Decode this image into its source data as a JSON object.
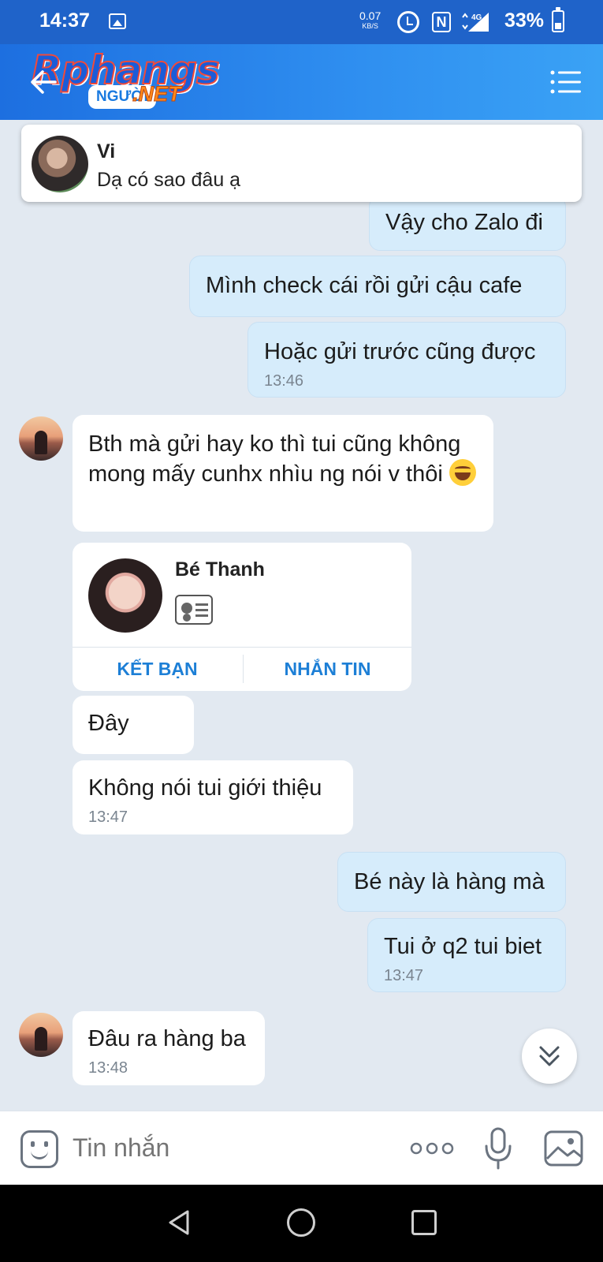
{
  "status_bar": {
    "time": "14:37",
    "net_speed": "0.07",
    "net_speed_unit": "KB/S",
    "nfc": "N",
    "network_type": "4G",
    "battery": "33%"
  },
  "header": {
    "logo_main": "Rphangs",
    "logo_sub": "NGƯỜI",
    "logo_net": ".NET"
  },
  "pinned": {
    "name": "Vi",
    "message": "Dạ có sao đâu ạ"
  },
  "messages": [
    {
      "sender": "me",
      "text": "Vậy cho Zalo đi"
    },
    {
      "sender": "me",
      "text": "Mình check cái rồi gửi cậu cafe"
    },
    {
      "sender": "me",
      "text": "Hoặc gửi trước cũng được",
      "time": "13:46"
    },
    {
      "sender": "other",
      "text": "Bth mà gửi hay ko thì tui cũng không mong mấy cunhx nhìu ng nói v thôi"
    },
    {
      "sender": "other",
      "text": "Đây"
    },
    {
      "sender": "other",
      "text": "Không nói tui giới thiệu",
      "time": "13:47"
    },
    {
      "sender": "me",
      "text": "Bé này là hàng mà"
    },
    {
      "sender": "me",
      "text": "Tui ở q2 tui biet",
      "time": "13:47"
    },
    {
      "sender": "other",
      "text": "Đâu ra hàng ba",
      "time": "13:48"
    }
  ],
  "contact_card": {
    "name": "Bé Thanh",
    "add_friend_label": "KẾT BẠN",
    "message_label": "NHẮN TIN"
  },
  "input": {
    "placeholder": "Tin nhắn"
  },
  "icons": {
    "back": "back-arrow-icon",
    "menu": "menu-icon",
    "emoji": "sticker-icon",
    "more": "more-dots-icon",
    "mic": "microphone-icon",
    "image": "image-icon",
    "scroll_down": "double-chevron-down-icon"
  },
  "colors": {
    "header": "#2a84ec",
    "my_bubble": "#d6ecfb",
    "other_bubble": "#ffffff",
    "chat_background": "#e2e9f1",
    "card_action": "#1d7fd6"
  }
}
